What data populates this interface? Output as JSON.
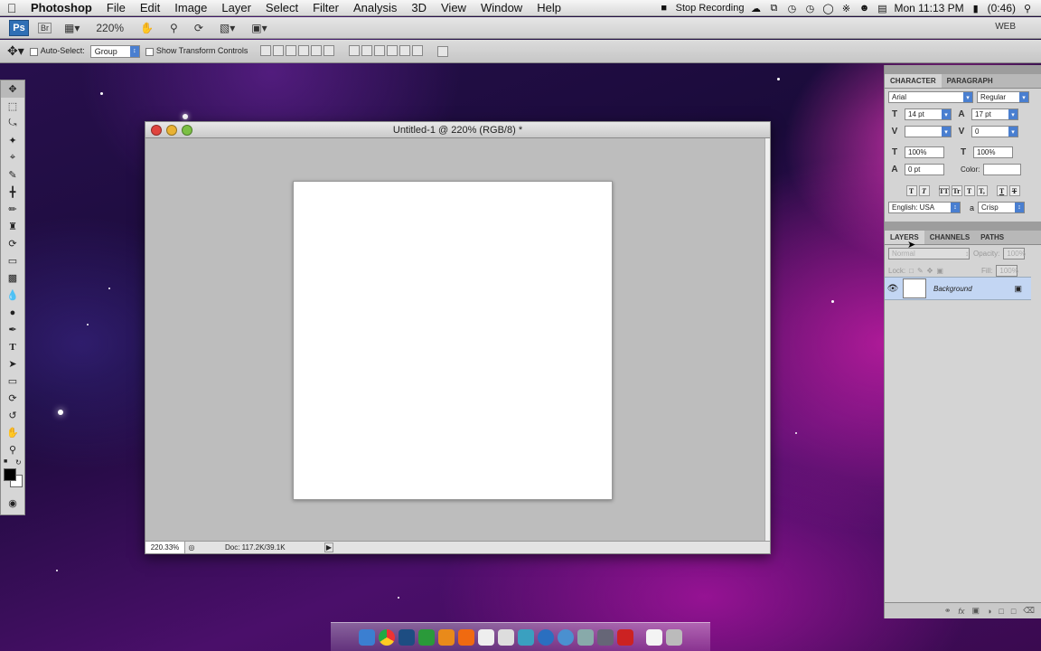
{
  "menubar": {
    "app_name": "Photoshop",
    "items": [
      "File",
      "Edit",
      "Image",
      "Layer",
      "Select",
      "Filter",
      "Analysis",
      "3D",
      "View",
      "Window",
      "Help"
    ],
    "status": {
      "recording": "Stop Recording",
      "clock": "Mon 11:13 PM",
      "battery": "(0:46)"
    }
  },
  "appbar": {
    "logo": "Ps",
    "bridge": "Br",
    "zoom": "220%",
    "workspace": "WEB"
  },
  "options": {
    "auto_select": "Auto-Select:",
    "group": "Group",
    "show_transform": "Show Transform Controls"
  },
  "document": {
    "title": "Untitled-1 @ 220% (RGB/8) *",
    "zoom": "220.33%",
    "doc_info": "Doc: 117.2K/39.1K"
  },
  "character_panel": {
    "tabs": [
      "CHARACTER",
      "PARAGRAPH"
    ],
    "font_family": "Arial",
    "font_style": "Regular",
    "font_size": "14 pt",
    "leading": "17 pt",
    "tracking": "0",
    "vertical_scale": "100%",
    "horizontal_scale": "100%",
    "baseline_shift": "0 pt",
    "color_label": "Color:",
    "language": "English: USA",
    "aa_label": "a",
    "antialias": "Crisp",
    "style_buttons": [
      "T",
      "T",
      "TT",
      "Tr",
      "T",
      "T,",
      "T",
      "T"
    ]
  },
  "layers_panel": {
    "tabs": [
      "LAYERS",
      "CHANNELS",
      "PATHS"
    ],
    "blend_mode": "Normal",
    "opacity_label": "Opacity:",
    "opacity": "100%",
    "lock_label": "Lock:",
    "fill_label": "Fill:",
    "fill": "100%",
    "layer_name": "Background"
  },
  "colors": {
    "layer_highlight": "#c3d6f3",
    "ps_blue": "#2f6fb5"
  }
}
